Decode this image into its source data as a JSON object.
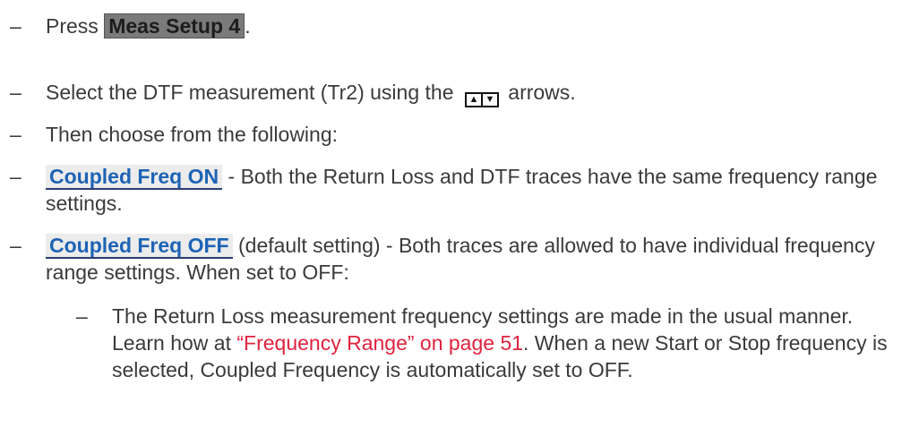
{
  "steps": {
    "press_prefix": "Press",
    "meas_setup_key": "Meas Setup 4",
    "press_suffix": ".",
    "select_prefix": "Select the DTF measurement (Tr2) using the",
    "select_suffix": "arrows.",
    "arrow_icon": "up-down-arrow-keys-icon",
    "choose": "Then choose from the following:"
  },
  "options": {
    "coupled_on_key": "Coupled Freq ON",
    "coupled_on_text": "- Both the Return Loss and DTF traces have the same frequency range settings.",
    "coupled_off_key": "Coupled Freq OFF",
    "coupled_off_text": "(default setting) - Both traces are allowed to have individual frequency range settings. When set to OFF:"
  },
  "sub": {
    "prefix": "The Return Loss measurement frequency settings are made in the usual manner. Learn how at",
    "link": "“Frequency Range” on page 51",
    "suffix": ". When a new Start or Stop frequency is selected, Coupled Frequency is automatically set to OFF."
  },
  "colors": {
    "link": "#e0233f",
    "softkey_text": "#1e63b5",
    "hardkey_bg": "#7a7a7a"
  }
}
